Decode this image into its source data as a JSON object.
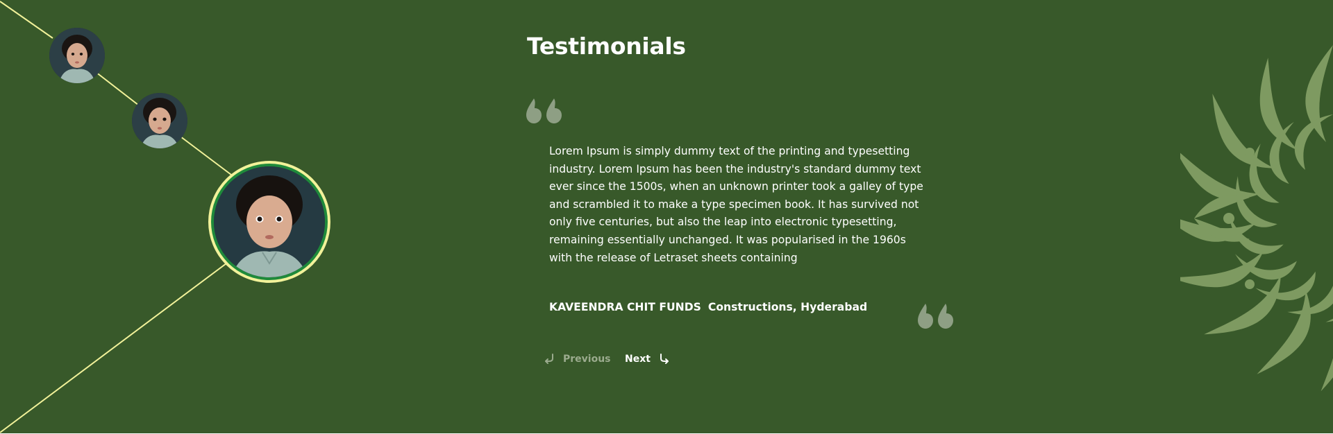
{
  "testimonials": {
    "title": "Testimonials",
    "body": "Lorem Ipsum is simply dummy text of the printing and typesetting industry. Lorem Ipsum has been the industry's standard dummy text ever since the 1500s, when an unknown printer took a galley of type and scrambled it to make a type specimen book. It has survived not only five centuries, but also the leap into electronic typesetting, remaining essentially unchanged. It was popularised in the 1960s with the release of Letraset sheets containing",
    "author_name": "KAVEENDRA CHIT FUNDS",
    "author_org": "Constructions, Hyderabad"
  },
  "navigation": {
    "previous_label": "Previous",
    "next_label": "Next",
    "previous_enabled": false,
    "next_enabled": true
  },
  "avatars": [
    {
      "icon": "child-portrait",
      "active": false
    },
    {
      "icon": "child-portrait",
      "active": false
    },
    {
      "icon": "child-portrait",
      "active": true
    }
  ],
  "colors": {
    "background": "#38592a",
    "line": "#f2f29a",
    "active_ring": "#1f8a3b",
    "quote_mark": "#8e9f84",
    "mandala": "#7e9a61",
    "nav_disabled": "#9bab8e",
    "text": "#ffffff"
  },
  "icons": {
    "open_quote": "quote-open-icon",
    "close_quote": "quote-close-icon",
    "previous": "arrow-return-left-icon",
    "next": "arrow-return-right-icon",
    "decoration": "mandala-ornament"
  }
}
